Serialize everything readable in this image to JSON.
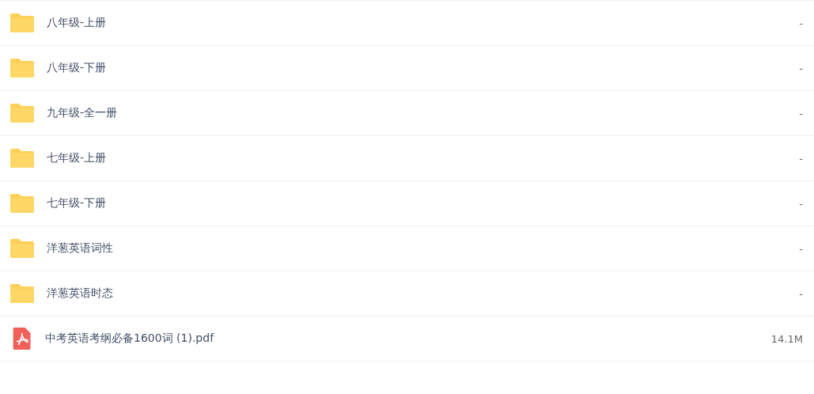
{
  "files": [
    {
      "kind": "folder",
      "name": "八年级-上册",
      "size": "-"
    },
    {
      "kind": "folder",
      "name": "八年级-下册",
      "size": "-"
    },
    {
      "kind": "folder",
      "name": "九年级-全一册",
      "size": "-"
    },
    {
      "kind": "folder",
      "name": "七年级-上册",
      "size": "-"
    },
    {
      "kind": "folder",
      "name": "七年级-下册",
      "size": "-"
    },
    {
      "kind": "folder",
      "name": "洋葱英语词性",
      "size": "-"
    },
    {
      "kind": "folder",
      "name": "洋葱英语时态",
      "size": "-"
    },
    {
      "kind": "pdf",
      "name": "中考英语考纲必备1600词 (1).pdf",
      "size": "14.1M"
    }
  ]
}
